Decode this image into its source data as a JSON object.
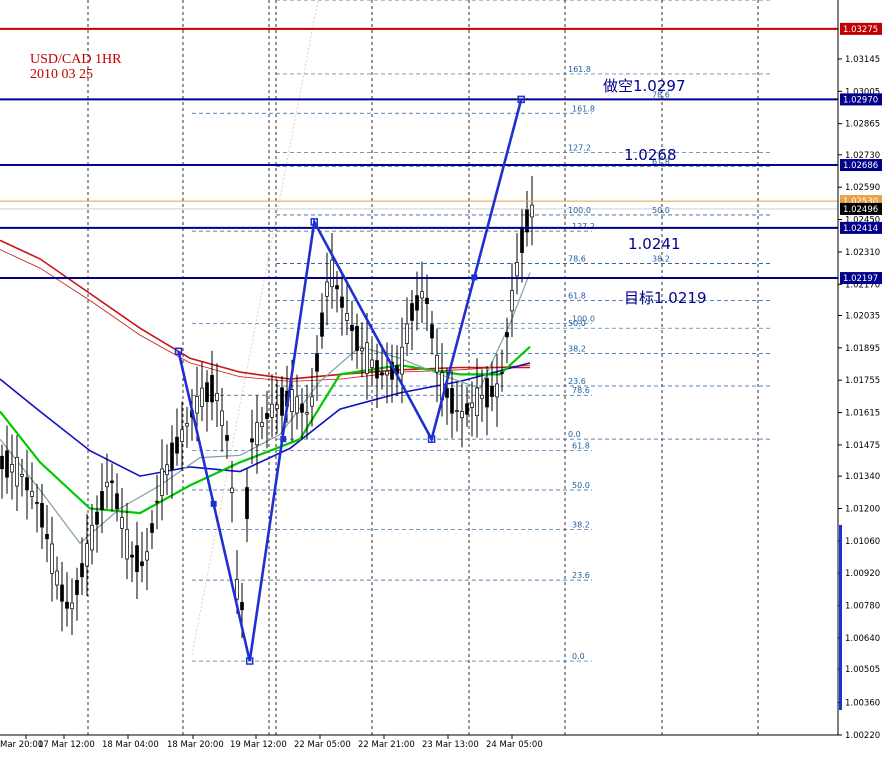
{
  "header": {
    "symbol": "USD/CAD 1HR",
    "date": "2010 03 25"
  },
  "colors": {
    "background": "#ffffff",
    "candle": "#000000",
    "price_line": "#c00000",
    "level_line": "#00008b",
    "harmonic": "#1f2fd0",
    "fib": "#1f5fa0",
    "ma_red": "#c81414",
    "ma_green": "#00c800",
    "ma_blue": "#1010c0",
    "ma_gray": "#7fa0a0",
    "current_price": "#e8a040"
  },
  "chart_data": {
    "type": "candlestick",
    "ylim": [
      1.0022,
      1.034
    ],
    "y_ticks": [
      "1.03145",
      "1.03005",
      "1.02865",
      "1.02730",
      "1.02590",
      "1.02450",
      "1.02310",
      "1.02170",
      "1.02035",
      "1.01895",
      "1.01755",
      "1.01615",
      "1.01475",
      "1.01340",
      "1.01200",
      "1.01060",
      "1.00920",
      "1.00780",
      "1.00640",
      "1.00505",
      "1.00360",
      "1.00220"
    ],
    "x_ticks": [
      "Mar 20:00",
      "17 Mar 12:00",
      "18 Mar 04:00",
      "18 Mar 20:00",
      "19 Mar 12:00",
      "22 Mar 05:00",
      "22 Mar 21:00",
      "23 Mar 13:00",
      "24 Mar 05:00"
    ],
    "price_tags": [
      {
        "label": "1.03275",
        "value": 1.03275,
        "style": "red"
      },
      {
        "label": "1.02970",
        "value": 1.0297,
        "style": "blue"
      },
      {
        "label": "1.02686",
        "value": 1.02686,
        "style": "blue"
      },
      {
        "label": "1.02530",
        "value": 1.0253,
        "style": "orange"
      },
      {
        "label": "1.02496",
        "value": 1.02496,
        "style": "black"
      },
      {
        "label": "1.02414",
        "value": 1.02414,
        "style": "blue"
      },
      {
        "label": "1.02197",
        "value": 1.02197,
        "style": "blue"
      }
    ],
    "horizontal_levels": [
      1.03275,
      1.0297,
      1.02686,
      1.02414,
      1.02197
    ],
    "annotations": [
      {
        "text": "做空1.0297",
        "value": 1.0297
      },
      {
        "text": "1.0268",
        "value": 1.0268
      },
      {
        "text": "1.0241",
        "value": 1.0241
      },
      {
        "text": "目标1.0219",
        "value": 1.0219
      }
    ],
    "fib_sets": [
      {
        "name": "fib-a",
        "levels": [
          {
            "label": "0.0",
            "value": 1.0054
          },
          {
            "label": "23.6",
            "value": 1.0089
          },
          {
            "label": "38.2",
            "value": 1.0111
          },
          {
            "label": "50.0",
            "value": 1.0128
          },
          {
            "label": "61.8",
            "value": 1.0145
          },
          {
            "label": "78.6",
            "value": 1.0169
          },
          {
            "label": "100.0",
            "value": 1.02
          },
          {
            "label": "127.2",
            "value": 1.024
          },
          {
            "label": "161.8",
            "value": 1.0291
          }
        ]
      },
      {
        "name": "fib-b",
        "levels": [
          {
            "label": "0.0",
            "value": 1.015
          },
          {
            "label": "23.6",
            "value": 1.0173
          },
          {
            "label": "38.2",
            "value": 1.0187
          },
          {
            "label": "50.0",
            "value": 1.0198
          },
          {
            "label": "61.8",
            "value": 1.021
          },
          {
            "label": "78.6",
            "value": 1.0226
          },
          {
            "label": "100.0",
            "value": 1.0247
          },
          {
            "label": "127.2",
            "value": 1.0274
          },
          {
            "label": "161.8",
            "value": 1.0308
          }
        ]
      },
      {
        "name": "fib-c",
        "levels": [
          {
            "label": "38.2",
            "value": 1.0226
          },
          {
            "label": "50.0",
            "value": 1.0247
          },
          {
            "label": "61.8",
            "value": 1.0268
          },
          {
            "label": "78.6",
            "value": 1.0297
          },
          {
            "label": "100.0",
            "value": 1.034
          }
        ]
      }
    ],
    "pattern_points": [
      {
        "t": 0.213,
        "v": 1.0188
      },
      {
        "t": 0.298,
        "v": 1.0054
      },
      {
        "t": 0.375,
        "v": 1.0244
      },
      {
        "t": 0.515,
        "v": 1.015
      },
      {
        "t": 0.622,
        "v": 1.0297
      }
    ],
    "pattern_dots": [
      {
        "t": 0.255,
        "v": 1.0122
      },
      {
        "t": 0.338,
        "v": 1.015
      },
      {
        "t": 0.566,
        "v": 1.022
      }
    ]
  }
}
